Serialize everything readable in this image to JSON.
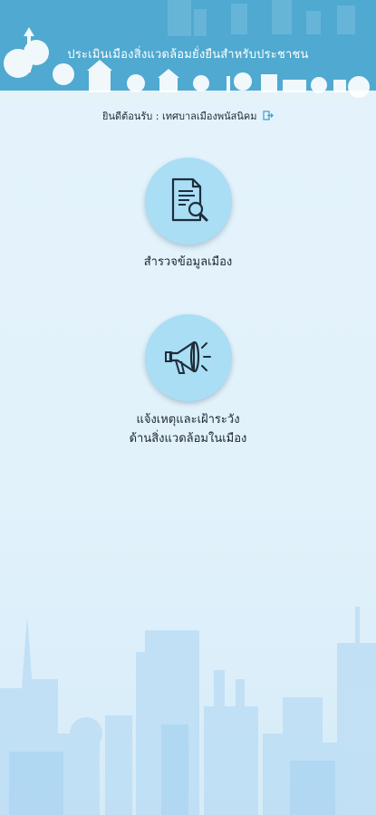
{
  "header": {
    "title": "ประเมินเมืองสิ่งแวดล้อมยั่งยืนสำหรับประชาชน"
  },
  "welcome": {
    "text": "ยินดีต้อนรับ : เทศบาลเมืองพนัสนิคม",
    "logout_icon": "logout-icon"
  },
  "actions": [
    {
      "label": "สำรวจข้อมูลเมือง",
      "icon": "document-search-icon"
    },
    {
      "label_line1": "แจ้งเหตุและเฝ้าระวัง",
      "label_line2": "ด้านสิ่งแวดล้อมในเมือง",
      "icon": "megaphone-icon"
    }
  ],
  "colors": {
    "header": "#4fa9d0",
    "circle": "#a9def5",
    "background": "#e4f3fb",
    "accent": "#4b9fd6"
  }
}
